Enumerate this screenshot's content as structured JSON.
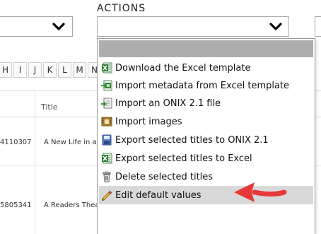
{
  "header": {
    "actions_label": "ACTIONS"
  },
  "alphabet": [
    "H",
    "I",
    "J",
    "K",
    "L",
    "M",
    "N"
  ],
  "table": {
    "columns": [
      "Title"
    ],
    "rows": [
      {
        "id": "4110307",
        "title": "A New Life in a"
      },
      {
        "id": "5805341",
        "title": "A Readers Thea"
      }
    ]
  },
  "actions_menu": {
    "items": [
      {
        "label": "Download the Excel template",
        "icon": "excel-icon"
      },
      {
        "label": "Import metadata from Excel template",
        "icon": "excel-import-icon"
      },
      {
        "label": "Import an ONIX 2.1 file",
        "icon": "onix-import-icon"
      },
      {
        "label": "Import images",
        "icon": "images-icon"
      },
      {
        "label": "Export selected titles to ONIX 2.1",
        "icon": "onix-export-icon"
      },
      {
        "label": "Export selected titles to Excel",
        "icon": "excel-icon"
      },
      {
        "label": "Delete selected titles",
        "icon": "trash-icon"
      },
      {
        "label": "Edit default values",
        "icon": "pencil-icon"
      }
    ],
    "highlighted_item": "Edit default values"
  },
  "colors": {
    "menu_header": "#aeaeae",
    "highlight": "#d9d9d9",
    "annotation_arrow": "#e8393a",
    "excel_green": "#2e7d32"
  }
}
